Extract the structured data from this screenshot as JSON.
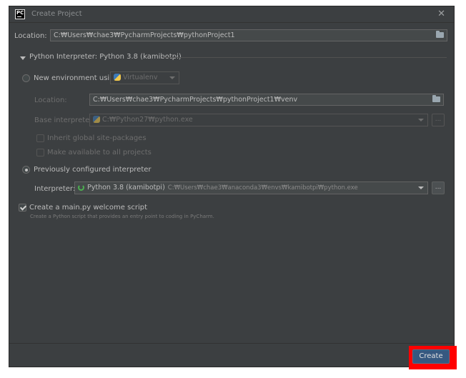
{
  "window": {
    "title": "Create Project",
    "app_icon_text": "PC"
  },
  "location": {
    "label": "Location:",
    "value": "C:₩Users₩chae3₩PycharmProjects₩pythonProject1"
  },
  "interpreter_section": {
    "title": "Python Interpreter: Python 3.8 (kamibotpi)"
  },
  "new_env": {
    "label": "New environment using",
    "tool_value": "Virtualenv",
    "location_label": "Location:",
    "location_value": "C:₩Users₩chae3₩PycharmProjects₩pythonProject1₩venv",
    "base_label": "Base interpreter:",
    "base_value": "C:₩Python27₩python.exe",
    "inherit_label": "Inherit global site-packages",
    "available_label": "Make available to all projects"
  },
  "prev_config": {
    "label": "Previously configured interpreter",
    "interpreter_label": "Interpreter:",
    "interpreter_name": "Python 3.8 (kamibotpi)",
    "interpreter_path": "C:₩Users₩chae3₩anaconda3₩envs₩kamibotpi₩python.exe"
  },
  "welcome": {
    "label": "Create a main.py welcome script",
    "hint": "Create a Python script that provides an entry point to coding in PyCharm."
  },
  "dots_label": "...",
  "close_glyph": "✕",
  "create_label": "Create"
}
